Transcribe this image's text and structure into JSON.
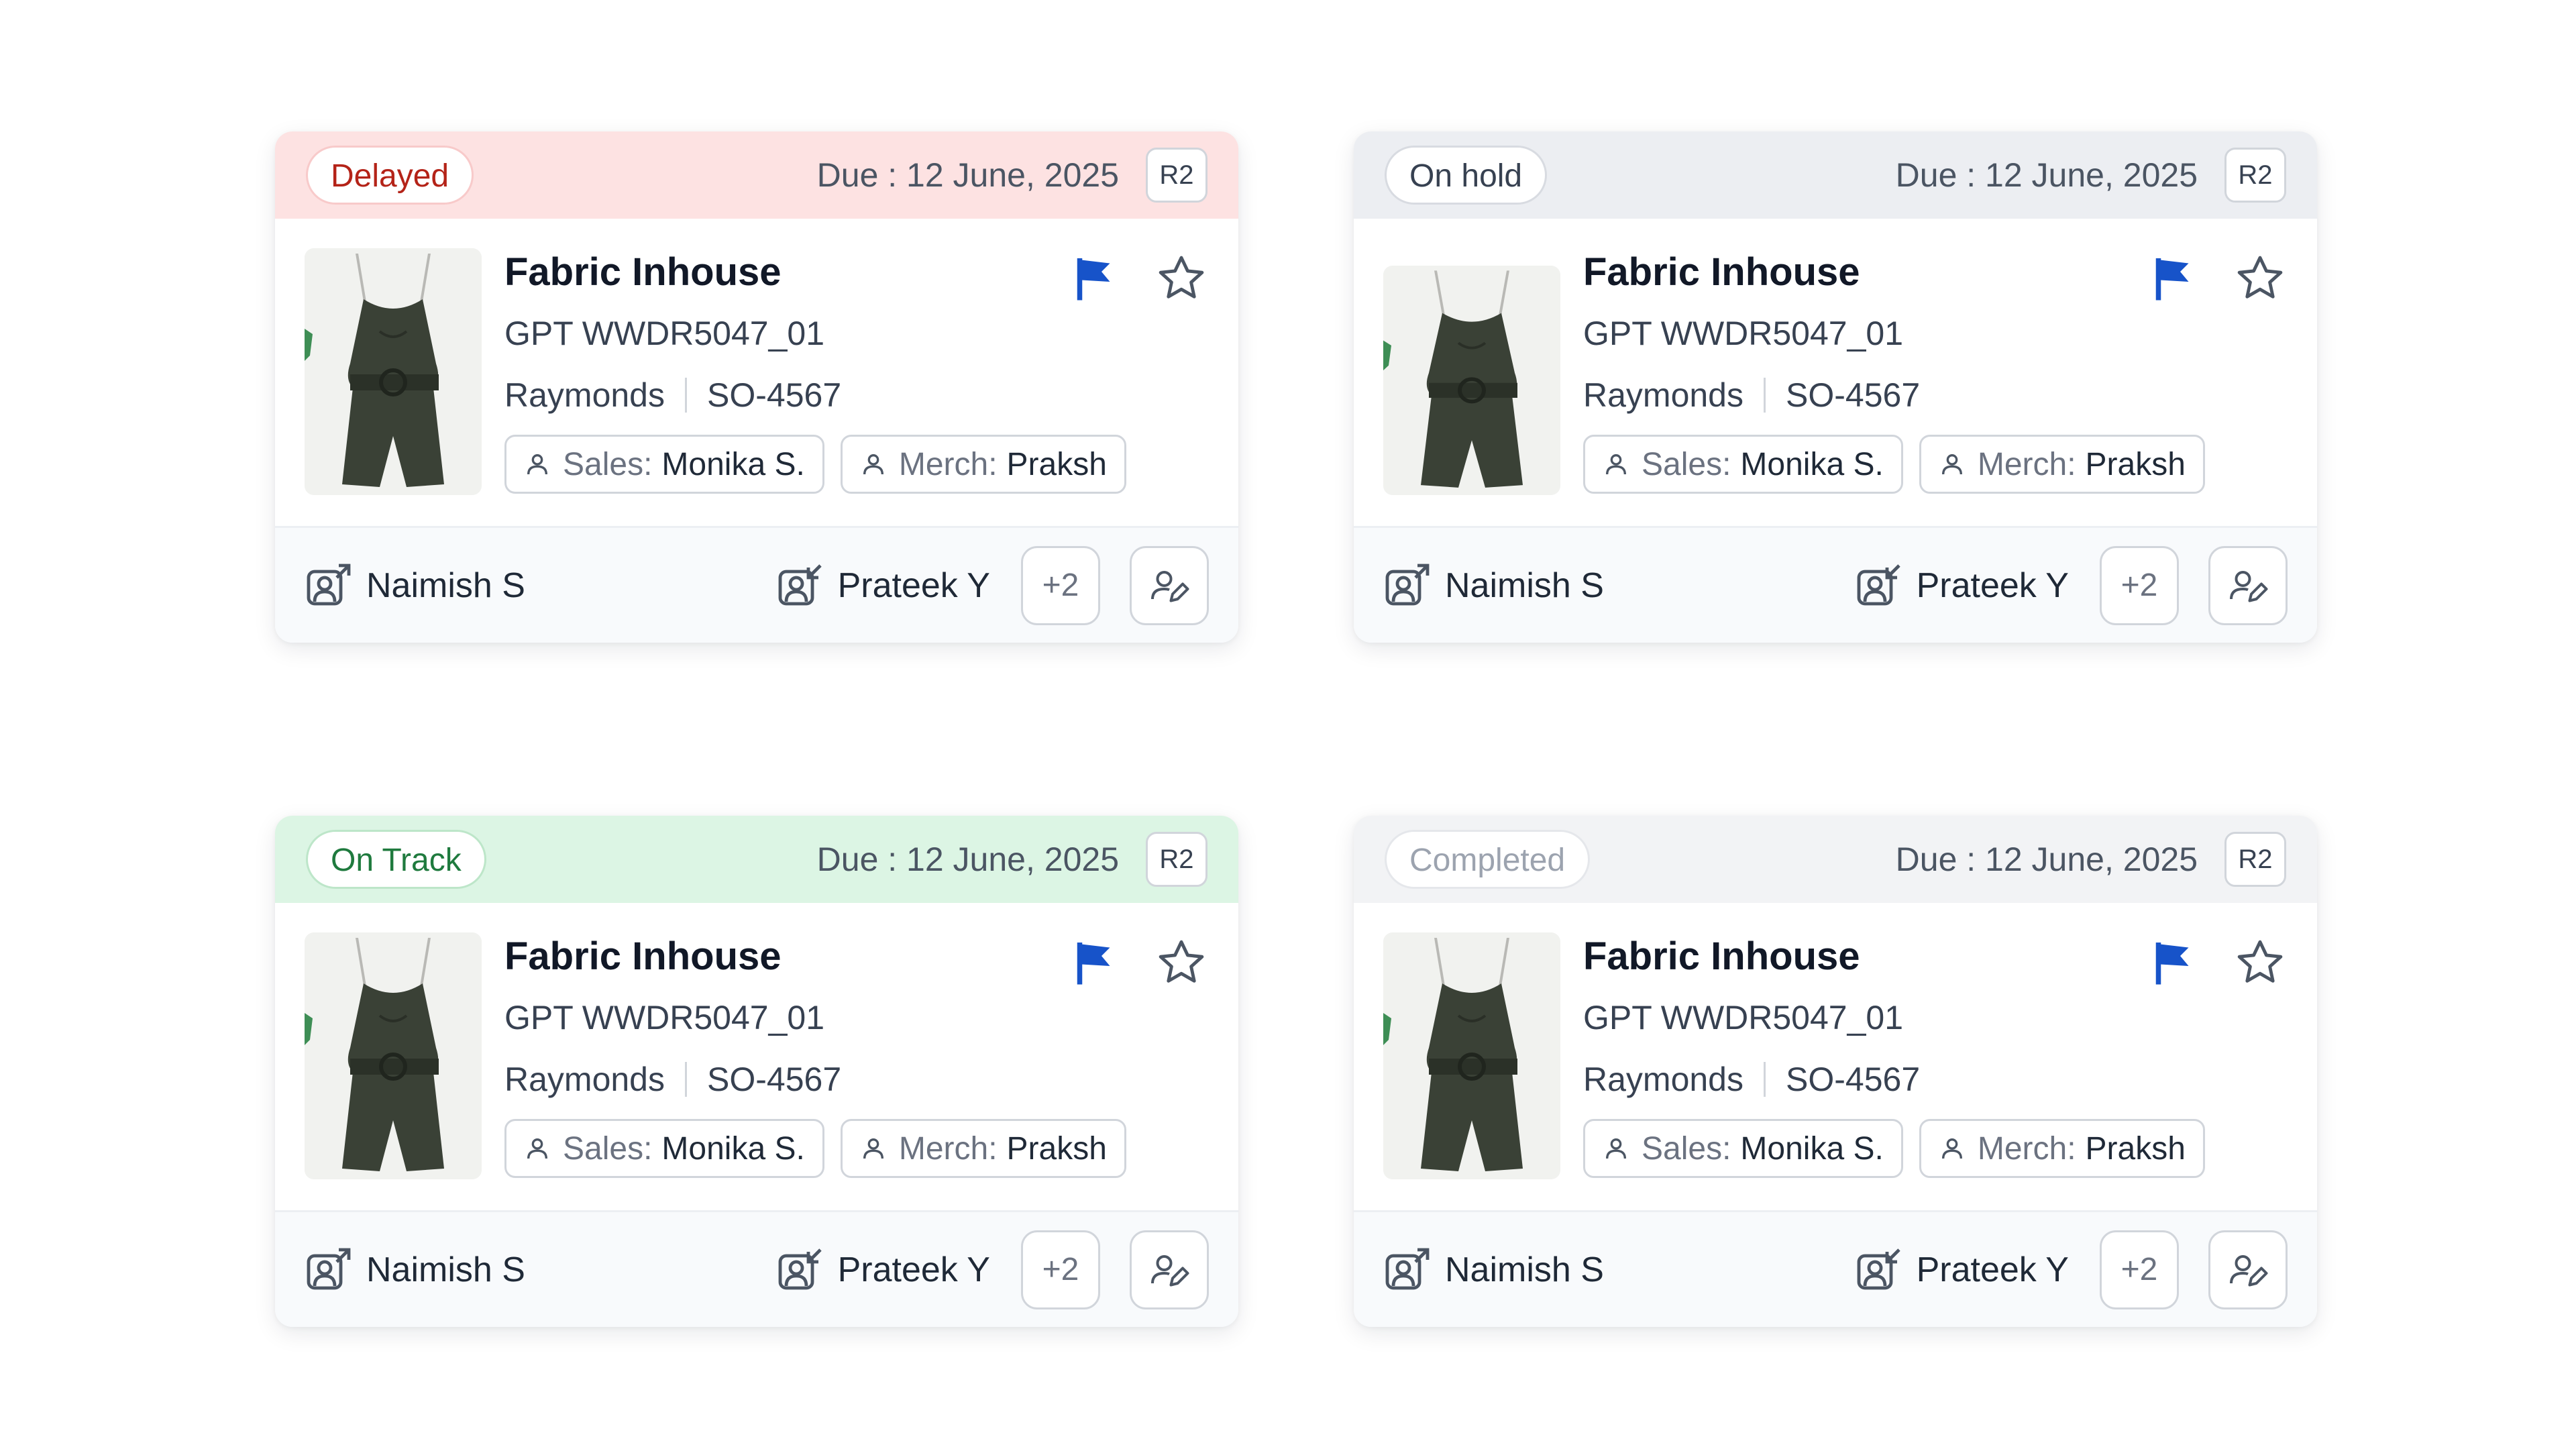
{
  "colors": {
    "flag": "#1753c9",
    "delayed_bg": "#fde2e2",
    "delayed_text": "#b42318",
    "delayed_border": "#f8caca",
    "onhold_bg": "#eceef2",
    "onhold_text": "#374151",
    "onhold_border": "#d8dbe1",
    "ontrack_bg": "#dcf5e4",
    "ontrack_text": "#1f7a3e",
    "ontrack_border": "#bde6c9",
    "completed_bg": "#f2f3f5",
    "completed_text": "#9ca3af",
    "completed_border": "#e5e7eb"
  },
  "cards": [
    {
      "status": "Delayed",
      "due": "Due : 12 June, 2025",
      "revision": "R2",
      "title": "Fabric Inhouse",
      "style_code": "GPT WWDR5047_01",
      "buyer": "Raymonds",
      "order": "SO-4567",
      "sales_label": "Sales:",
      "sales_name": "Monika S.",
      "merch_label": "Merch:",
      "merch_name": "Praksh",
      "assignee_primary": "Naimish S",
      "assignee_secondary": "Prateek Y",
      "more_count": "+2",
      "icons": {
        "flag": "flag-icon",
        "star": "star-icon",
        "edit": "user-edit-icon"
      }
    },
    {
      "status": "On hold",
      "due": "Due : 12 June, 2025",
      "revision": "R2",
      "title": "Fabric Inhouse",
      "style_code": "GPT WWDR5047_01",
      "buyer": "Raymonds",
      "order": "SO-4567",
      "sales_label": "Sales:",
      "sales_name": "Monika S.",
      "merch_label": "Merch:",
      "merch_name": "Praksh",
      "assignee_primary": "Naimish S",
      "assignee_secondary": "Prateek Y",
      "more_count": "+2",
      "icons": {
        "flag": "flag-icon",
        "star": "star-icon",
        "edit": "user-edit-icon"
      }
    },
    {
      "status": "On Track",
      "due": "Due : 12 June, 2025",
      "revision": "R2",
      "title": "Fabric Inhouse",
      "style_code": "GPT WWDR5047_01",
      "buyer": "Raymonds",
      "order": "SO-4567",
      "sales_label": "Sales:",
      "sales_name": "Monika S.",
      "merch_label": "Merch:",
      "merch_name": "Praksh",
      "assignee_primary": "Naimish S",
      "assignee_secondary": "Prateek Y",
      "more_count": "+2",
      "icons": {
        "flag": "flag-icon",
        "star": "star-icon",
        "edit": "user-edit-icon"
      }
    },
    {
      "status": "Completed",
      "due": "Due : 12 June, 2025",
      "revision": "R2",
      "title": "Fabric Inhouse",
      "style_code": "GPT WWDR5047_01",
      "buyer": "Raymonds",
      "order": "SO-4567",
      "sales_label": "Sales:",
      "sales_name": "Monika S.",
      "merch_label": "Merch:",
      "merch_name": "Praksh",
      "assignee_primary": "Naimish S",
      "assignee_secondary": "Prateek Y",
      "more_count": "+2",
      "icons": {
        "flag": "flag-icon",
        "star": "star-icon",
        "edit": "user-edit-icon"
      }
    }
  ]
}
